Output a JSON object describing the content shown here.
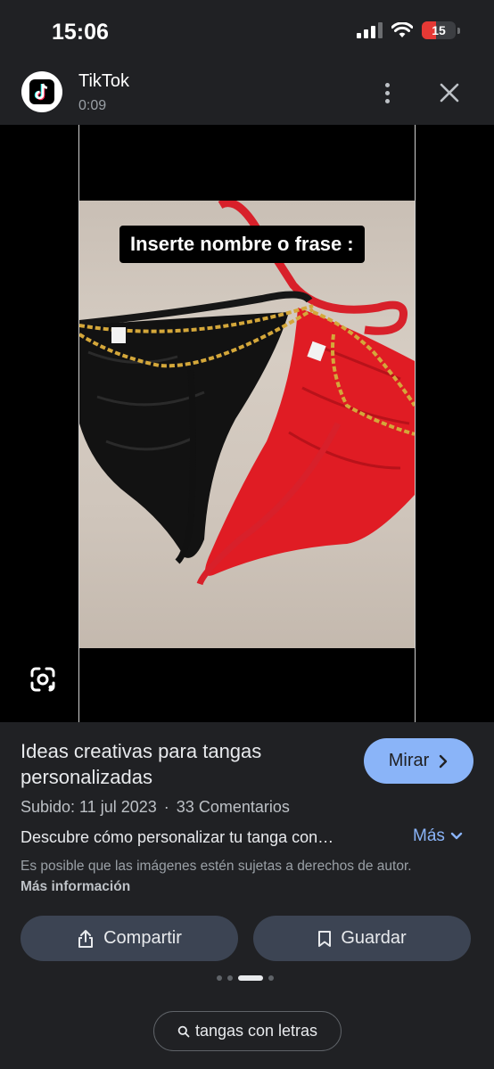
{
  "status_bar": {
    "time": "15:06",
    "battery_level": "15",
    "icons": [
      "cellular-signal-icon",
      "wifi-icon",
      "battery-icon"
    ],
    "battery_color": "#e53935"
  },
  "header": {
    "app_name": "TikTok",
    "duration": "0:09",
    "icons": [
      "tiktok-logo-icon",
      "more-vert-icon",
      "close-icon"
    ]
  },
  "media": {
    "overlay_text": "Inserte nombre o frase :",
    "lens_icon": "google-lens-icon"
  },
  "result": {
    "title": "Ideas creativas para tangas personalizadas",
    "watch_label": "Mirar",
    "uploaded": "Subido: 11 jul 2023",
    "separator": "·",
    "comments": "33 Comentarios",
    "description": "Descubre cómo personalizar tu tanga con…",
    "more_label": "Más",
    "copyright_text": "Es posible que las imágenes estén sujetas a derechos de autor.",
    "copyright_link": "Más información",
    "accent_color": "#8ab4f8"
  },
  "actions": {
    "share_label": "Compartir",
    "save_label": "Guardar"
  },
  "pagination": {
    "count": 4,
    "active_index": 2
  },
  "related_search": {
    "label": "tangas con letras"
  }
}
